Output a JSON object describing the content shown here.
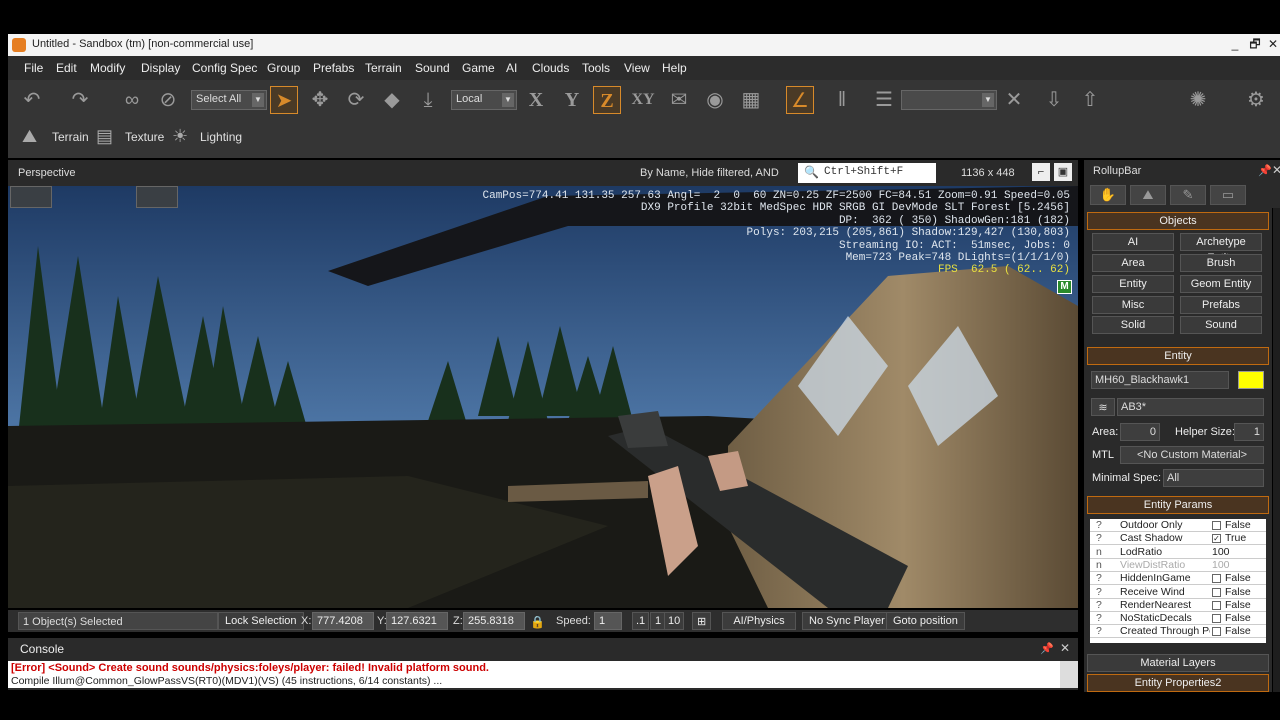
{
  "window": {
    "title": "Untitled - Sandbox (tm) [non-commercial use]",
    "minimize": "_",
    "restore": "🗗",
    "close": "✕"
  },
  "menu": [
    "File",
    "Edit",
    "Modify",
    "Display",
    "Config Spec",
    "Group",
    "Prefabs",
    "Terrain",
    "Sound",
    "Game",
    "AI",
    "Clouds",
    "Tools",
    "View",
    "Help"
  ],
  "toolbar": {
    "select_mode": "Select All",
    "coord_system": "Local",
    "axis_x": "X",
    "axis_y": "Y",
    "axis_z": "Z",
    "axis_xy": "XY"
  },
  "toolbar2": {
    "terrain": "Terrain",
    "texture": "Texture",
    "lighting": "Lighting"
  },
  "viewport": {
    "name": "Perspective",
    "filter_text": "By Name, Hide filtered, AND",
    "search_placeholder": "Ctrl+Shift+F",
    "resolution": "1136 x 448",
    "hud": {
      "line1": "CamPos=774.41 131.35 257.63 Angl=  2  0  60 ZN=0.25 ZF=2500 FC=84.51 Zoom=0.91 Speed=0.05",
      "line2": "DX9 Profile 32bit MedSpec HDR SRGB GI DevMode SLT Forest [5.2456]",
      "line3": "DP:  362 ( 350) ShadowGen:181 (182)",
      "line4": "Polys: 203,215 (205,861) Shadow:129,427 (130,803)",
      "line5": "Streaming IO: ACT:  51msec, Jobs: 0",
      "line6": "Mem=723 Peak=748 DLights=(1/1/1/0)",
      "fps": "FPS  62.5 ( 62.. 62)",
      "badge": "M"
    }
  },
  "statusbar": {
    "selection": "1 Object(s) Selected",
    "lock_selection": "Lock Selection",
    "x_label": "X:",
    "x_value": "777.4208",
    "y_label": "Y:",
    "y_value": "127.6321",
    "z_label": "Z:",
    "z_value": "255.8318",
    "speed_label": "Speed:",
    "speed_value": "1",
    "speed_presets": [
      ".1",
      "1",
      "10"
    ],
    "ai_physics": "AI/Physics",
    "no_sync_player": "No Sync Player",
    "goto_position": "Goto position"
  },
  "console": {
    "title": "Console",
    "error_line": "[Error] <Sound> Create sound sounds/physics:foleys/player: failed! Invalid platform sound.",
    "info_line": "Compile Illum@Common_GlowPassVS(RT0)(MDV1)(VS) (45 instructions, 6/14 constants) ..."
  },
  "rollup": {
    "title": "RollupBar",
    "objects_header": "Objects",
    "object_buttons": [
      "AI",
      "Archetype Entity",
      "Area",
      "Brush",
      "Entity",
      "Geom Entity",
      "Misc",
      "Prefabs",
      "Solid",
      "Sound"
    ],
    "entity_header": "Entity",
    "entity_name": "MH60_Blackhawk1",
    "entity_color": "#ffff00",
    "layer": "AB3*",
    "area_label": "Area:",
    "area_value": "0",
    "helper_label": "Helper Size:",
    "helper_value": "1",
    "mtl_label": "MTL",
    "mtl_value": "<No Custom Material>",
    "minspec_label": "Minimal Spec:",
    "minspec_value": "All",
    "params_header": "Entity Params",
    "params": [
      {
        "q": "?",
        "name": "Outdoor Only",
        "type": "bool",
        "checked": "",
        "value": "False"
      },
      {
        "q": "?",
        "name": "Cast Shadow",
        "type": "bool",
        "checked": "✓",
        "value": "True"
      },
      {
        "q": "n",
        "name": "LodRatio",
        "type": "num",
        "value": "100"
      },
      {
        "q": "n",
        "name": "ViewDistRatio",
        "type": "num",
        "value": "100"
      },
      {
        "q": "?",
        "name": "HiddenInGame",
        "type": "bool",
        "checked": "",
        "value": "False"
      },
      {
        "q": "?",
        "name": "Receive Wind",
        "type": "bool",
        "checked": "",
        "value": "False"
      },
      {
        "q": "?",
        "name": "RenderNearest",
        "type": "bool",
        "checked": "",
        "value": "False"
      },
      {
        "q": "?",
        "name": "NoStaticDecals",
        "type": "bool",
        "checked": "",
        "value": "False"
      },
      {
        "q": "?",
        "name": "Created Through Pool",
        "type": "bool",
        "checked": "",
        "value": "False"
      }
    ],
    "material_layers_header": "Material Layers",
    "entity_props2_header": "Entity Properties2"
  },
  "colors": {
    "accent": "#d88a2a",
    "error": "#cc0000",
    "panel": "#2a2a2a"
  }
}
